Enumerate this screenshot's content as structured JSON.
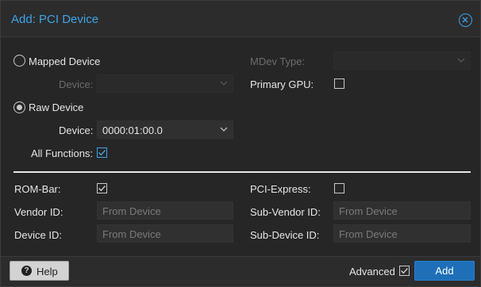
{
  "dialog": {
    "title": "Add: PCI Device"
  },
  "mapped": {
    "radio_label": "Mapped Device",
    "device_label": "Device:",
    "device_value": ""
  },
  "mdev": {
    "label": "MDev Type:",
    "value": ""
  },
  "primary_gpu": {
    "label": "Primary GPU:",
    "checked": false
  },
  "raw": {
    "radio_label": "Raw Device",
    "device_label": "Device:",
    "device_value": "0000:01:00.0"
  },
  "all_functions": {
    "label": "All Functions:",
    "checked": true
  },
  "rom_bar": {
    "label": "ROM-Bar:",
    "checked": true
  },
  "pci_express": {
    "label": "PCI-Express:",
    "checked": false
  },
  "vendor_id": {
    "label": "Vendor ID:",
    "placeholder": "From Device"
  },
  "device_id": {
    "label": "Device ID:",
    "placeholder": "From Device"
  },
  "sub_vendor_id": {
    "label": "Sub-Vendor ID:",
    "placeholder": "From Device"
  },
  "sub_device_id": {
    "label": "Sub-Device ID:",
    "placeholder": "From Device"
  },
  "footer": {
    "help_label": "Help",
    "help_icon": "?",
    "advanced_label": "Advanced",
    "advanced_checked": true,
    "add_label": "Add"
  },
  "colors": {
    "accent": "#3fa3e6",
    "add_button": "#1e6fb8",
    "background": "#262626"
  }
}
